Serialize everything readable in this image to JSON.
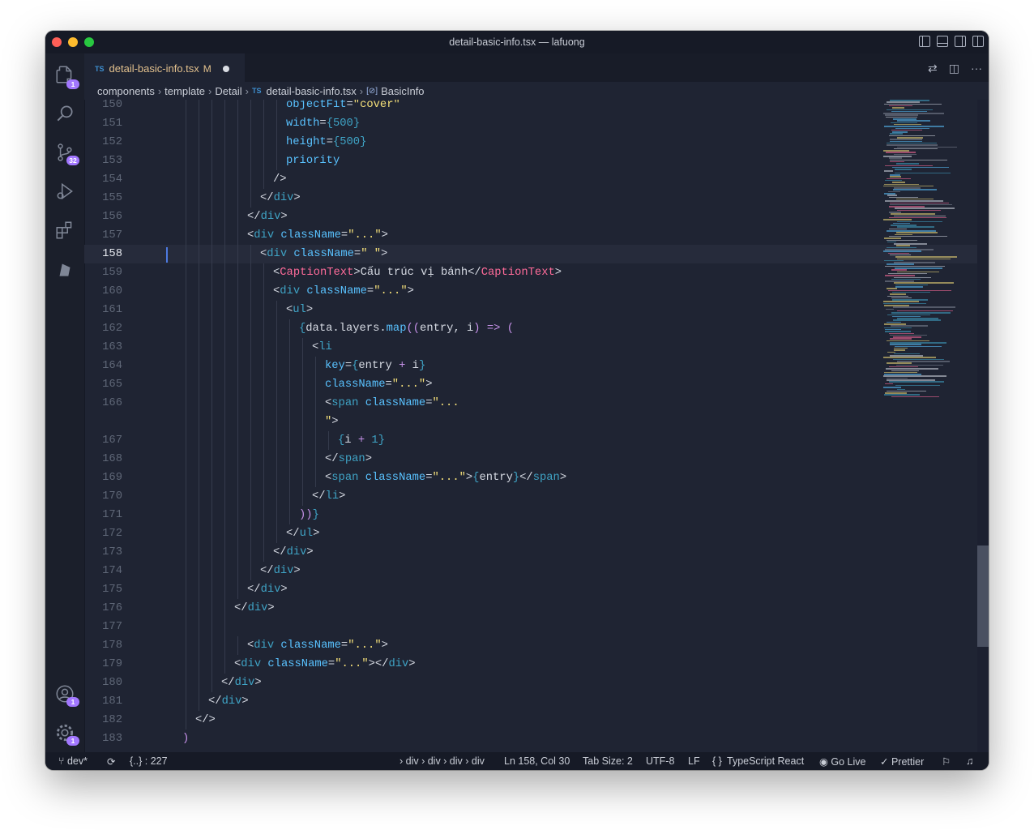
{
  "window": {
    "title": "detail-basic-info.tsx — lafuong"
  },
  "activity_bar": {
    "explorer_badge": "1",
    "scm_badge": "32",
    "accounts_badge": "1",
    "settings_badge": "1"
  },
  "tab": {
    "lang": "TS",
    "filename": "detail-basic-info.tsx",
    "status": "M"
  },
  "breadcrumb": {
    "items": [
      "components",
      "template",
      "Detail"
    ],
    "file_lang": "TS",
    "file": "detail-basic-info.tsx",
    "symbol": "BasicInfo"
  },
  "editor": {
    "current_line": "158",
    "lines": [
      {
        "n": "150",
        "parts": [
          [
            "attr",
            "objectFit"
          ],
          [
            "punct",
            "="
          ],
          [
            "str",
            "\"cover\""
          ]
        ]
      },
      {
        "n": "151",
        "parts": [
          [
            "attr",
            "width"
          ],
          [
            "punct",
            "="
          ],
          [
            "brace",
            "{"
          ],
          [
            "num",
            "500"
          ],
          [
            "brace",
            "}"
          ]
        ]
      },
      {
        "n": "152",
        "parts": [
          [
            "attr",
            "height"
          ],
          [
            "punct",
            "="
          ],
          [
            "brace",
            "{"
          ],
          [
            "num",
            "500"
          ],
          [
            "brace",
            "}"
          ]
        ]
      },
      {
        "n": "153",
        "parts": [
          [
            "attr",
            "priority"
          ]
        ]
      },
      {
        "n": "154",
        "parts": [
          [
            "punct",
            "/>"
          ]
        ]
      },
      {
        "n": "155",
        "parts": [
          [
            "punct",
            "</"
          ],
          [
            "tag",
            "div"
          ],
          [
            "punct",
            ">"
          ]
        ]
      },
      {
        "n": "156",
        "parts": [
          [
            "punct",
            "</"
          ],
          [
            "tag",
            "div"
          ],
          [
            "punct",
            ">"
          ]
        ]
      },
      {
        "n": "157",
        "parts": [
          [
            "punct",
            "<"
          ],
          [
            "tag",
            "div"
          ],
          [
            "punct",
            " "
          ],
          [
            "attr",
            "className"
          ],
          [
            "punct",
            "="
          ],
          [
            "str",
            "\"...\""
          ],
          [
            "punct",
            ">"
          ]
        ]
      },
      {
        "n": "158",
        "parts": [
          [
            "punct",
            "<"
          ],
          [
            "tag",
            "div"
          ],
          [
            "punct",
            " "
          ],
          [
            "attr",
            "className"
          ],
          [
            "punct",
            "="
          ],
          [
            "str",
            "\" \""
          ],
          [
            "punct",
            ">"
          ]
        ]
      },
      {
        "n": "159",
        "parts": [
          [
            "punct",
            "<"
          ],
          [
            "comp",
            "CaptionText"
          ],
          [
            "punct",
            ">"
          ],
          [
            "punct",
            "Cấu trúc vị bánh"
          ],
          [
            "punct",
            "</"
          ],
          [
            "comp",
            "CaptionText"
          ],
          [
            "punct",
            ">"
          ]
        ]
      },
      {
        "n": "160",
        "parts": [
          [
            "punct",
            "<"
          ],
          [
            "tag",
            "div"
          ],
          [
            "punct",
            " "
          ],
          [
            "attr",
            "className"
          ],
          [
            "punct",
            "="
          ],
          [
            "str",
            "\"...\""
          ],
          [
            "punct",
            ">"
          ]
        ]
      },
      {
        "n": "161",
        "parts": [
          [
            "punct",
            "<"
          ],
          [
            "tag",
            "ul"
          ],
          [
            "punct",
            ">"
          ]
        ]
      },
      {
        "n": "162",
        "parts": [
          [
            "brace",
            "{"
          ],
          [
            "punct",
            "data.layers."
          ],
          [
            "attr",
            "map"
          ],
          [
            "kw",
            "(("
          ],
          [
            "punct",
            "entry, i"
          ],
          [
            "kw",
            ")"
          ],
          [
            "punct",
            " "
          ],
          [
            "kw",
            "=>"
          ],
          [
            "punct",
            " "
          ],
          [
            "kw",
            "("
          ]
        ]
      },
      {
        "n": "163",
        "parts": [
          [
            "punct",
            "<"
          ],
          [
            "tag",
            "li"
          ]
        ]
      },
      {
        "n": "164",
        "parts": [
          [
            "attr",
            "key"
          ],
          [
            "punct",
            "="
          ],
          [
            "brace",
            "{"
          ],
          [
            "punct",
            "entry "
          ],
          [
            "kw",
            "+"
          ],
          [
            "punct",
            " i"
          ],
          [
            "brace",
            "}"
          ]
        ]
      },
      {
        "n": "165",
        "parts": [
          [
            "attr",
            "className"
          ],
          [
            "punct",
            "="
          ],
          [
            "str",
            "\"...\""
          ],
          [
            "punct",
            ">"
          ]
        ]
      },
      {
        "n": "166",
        "parts": [
          [
            "punct",
            "<"
          ],
          [
            "tag",
            "span"
          ],
          [
            "punct",
            " "
          ],
          [
            "attr",
            "className"
          ],
          [
            "punct",
            "="
          ],
          [
            "str",
            "\"..."
          ]
        ]
      },
      {
        "n": "",
        "parts": [
          [
            "str",
            "\""
          ],
          [
            "punct",
            ">"
          ]
        ]
      },
      {
        "n": "167",
        "parts": [
          [
            "brace",
            "{"
          ],
          [
            "punct",
            "i "
          ],
          [
            "kw",
            "+"
          ],
          [
            "punct",
            " "
          ],
          [
            "num",
            "1"
          ],
          [
            "brace",
            "}"
          ]
        ]
      },
      {
        "n": "168",
        "parts": [
          [
            "punct",
            "</"
          ],
          [
            "tag",
            "span"
          ],
          [
            "punct",
            ">"
          ]
        ]
      },
      {
        "n": "169",
        "parts": [
          [
            "punct",
            "<"
          ],
          [
            "tag",
            "span"
          ],
          [
            "punct",
            " "
          ],
          [
            "attr",
            "className"
          ],
          [
            "punct",
            "="
          ],
          [
            "str",
            "\"...\""
          ],
          [
            "punct",
            ">"
          ],
          [
            "brace",
            "{"
          ],
          [
            "punct",
            "entry"
          ],
          [
            "brace",
            "}"
          ],
          [
            "punct",
            "</"
          ],
          [
            "tag",
            "span"
          ],
          [
            "punct",
            ">"
          ]
        ]
      },
      {
        "n": "170",
        "parts": [
          [
            "punct",
            "</"
          ],
          [
            "tag",
            "li"
          ],
          [
            "punct",
            ">"
          ]
        ]
      },
      {
        "n": "171",
        "parts": [
          [
            "kw",
            "))"
          ],
          [
            "brace",
            "}"
          ]
        ]
      },
      {
        "n": "172",
        "parts": [
          [
            "punct",
            "</"
          ],
          [
            "tag",
            "ul"
          ],
          [
            "punct",
            ">"
          ]
        ]
      },
      {
        "n": "173",
        "parts": [
          [
            "punct",
            "</"
          ],
          [
            "tag",
            "div"
          ],
          [
            "punct",
            ">"
          ]
        ]
      },
      {
        "n": "174",
        "parts": [
          [
            "punct",
            "</"
          ],
          [
            "tag",
            "div"
          ],
          [
            "punct",
            ">"
          ]
        ]
      },
      {
        "n": "175",
        "parts": [
          [
            "punct",
            "</"
          ],
          [
            "tag",
            "div"
          ],
          [
            "punct",
            ">"
          ]
        ]
      },
      {
        "n": "176",
        "parts": [
          [
            "punct",
            "</"
          ],
          [
            "tag",
            "div"
          ],
          [
            "punct",
            ">"
          ]
        ]
      },
      {
        "n": "177",
        "parts": []
      },
      {
        "n": "178",
        "parts": [
          [
            "punct",
            "<"
          ],
          [
            "tag",
            "div"
          ],
          [
            "punct",
            " "
          ],
          [
            "attr",
            "className"
          ],
          [
            "punct",
            "="
          ],
          [
            "str",
            "\"...\""
          ],
          [
            "punct",
            ">"
          ]
        ]
      },
      {
        "n": "179",
        "parts": [
          [
            "punct",
            "<"
          ],
          [
            "tag",
            "div"
          ],
          [
            "punct",
            " "
          ],
          [
            "attr",
            "className"
          ],
          [
            "punct",
            "="
          ],
          [
            "str",
            "\"...\""
          ],
          [
            "punct",
            "></"
          ],
          [
            "tag",
            "div"
          ],
          [
            "punct",
            ">"
          ]
        ]
      },
      {
        "n": "180",
        "parts": [
          [
            "punct",
            "</"
          ],
          [
            "tag",
            "div"
          ],
          [
            "punct",
            ">"
          ]
        ]
      },
      {
        "n": "181",
        "parts": [
          [
            "punct",
            "</"
          ],
          [
            "tag",
            "div"
          ],
          [
            "punct",
            ">"
          ]
        ]
      },
      {
        "n": "182",
        "parts": [
          [
            "punct",
            "</>"
          ]
        ]
      },
      {
        "n": "183",
        "parts": [
          [
            "kw",
            ")"
          ]
        ]
      }
    ]
  },
  "status_bar": {
    "branch": "dev*",
    "outline": "{..} : 227",
    "path": "› div › div › div › div",
    "position": "Ln 158, Col 30",
    "tab_size": "Tab Size: 2",
    "encoding": "UTF-8",
    "eol": "LF",
    "language_icon": "{ }",
    "language": "TypeScript React",
    "go_live": "Go Live",
    "prettier": "Prettier"
  }
}
